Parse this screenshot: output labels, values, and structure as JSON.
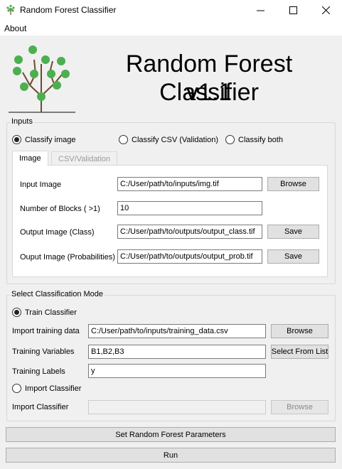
{
  "window": {
    "title": "Random Forest Classifier"
  },
  "menu": {
    "about": "About"
  },
  "header": {
    "title": "Random Forest Classifier",
    "version": "v1.1"
  },
  "inputs": {
    "group_label": "Inputs",
    "radios": {
      "classify_image": "Classify image",
      "classify_csv": "Classify CSV (Validation)",
      "classify_both": "Classify both",
      "selected": "classify_image"
    },
    "tabs": {
      "image": "Image",
      "csv_validation": "CSV/Validation",
      "active": "image"
    },
    "image_tab": {
      "input_image_label": "Input Image",
      "input_image_value": "C:/User/path/to/inputs/img.tif",
      "browse_label": "Browse",
      "blocks_label": "Number of Blocks ( >1)",
      "blocks_value": "10",
      "output_class_label": "Output Image (Class)",
      "output_class_value": "C:/User/path/to/outputs/output_class.tif",
      "save_class_label": "Save",
      "output_prob_label": "Ouput Image (Probabilities)",
      "output_prob_value": "C:/User/path/to/outputs/output_prob.tif",
      "save_prob_label": "Save"
    }
  },
  "mode": {
    "group_label": "Select Classification Mode",
    "train_radio": "Train Classifier",
    "import_radio": "Import Classifier",
    "selected": "train",
    "training_data_label": "Import training data",
    "training_data_value": "C:/User/path/to/inputs/training_data.csv",
    "training_data_browse": "Browse",
    "variables_label": "Training Variables",
    "variables_value": "B1,B2,B3",
    "select_from_list": "Select From List",
    "labels_label": "Training Labels",
    "labels_value": "y",
    "import_classifier_label": "Import Classifier",
    "import_classifier_value": "",
    "import_classifier_browse": "Browse"
  },
  "actions": {
    "set_params": "Set Random Forest Parameters",
    "run": "Run"
  },
  "colors": {
    "logo_leaf": "#4caf50",
    "logo_trunk": "#6d4c2a"
  }
}
